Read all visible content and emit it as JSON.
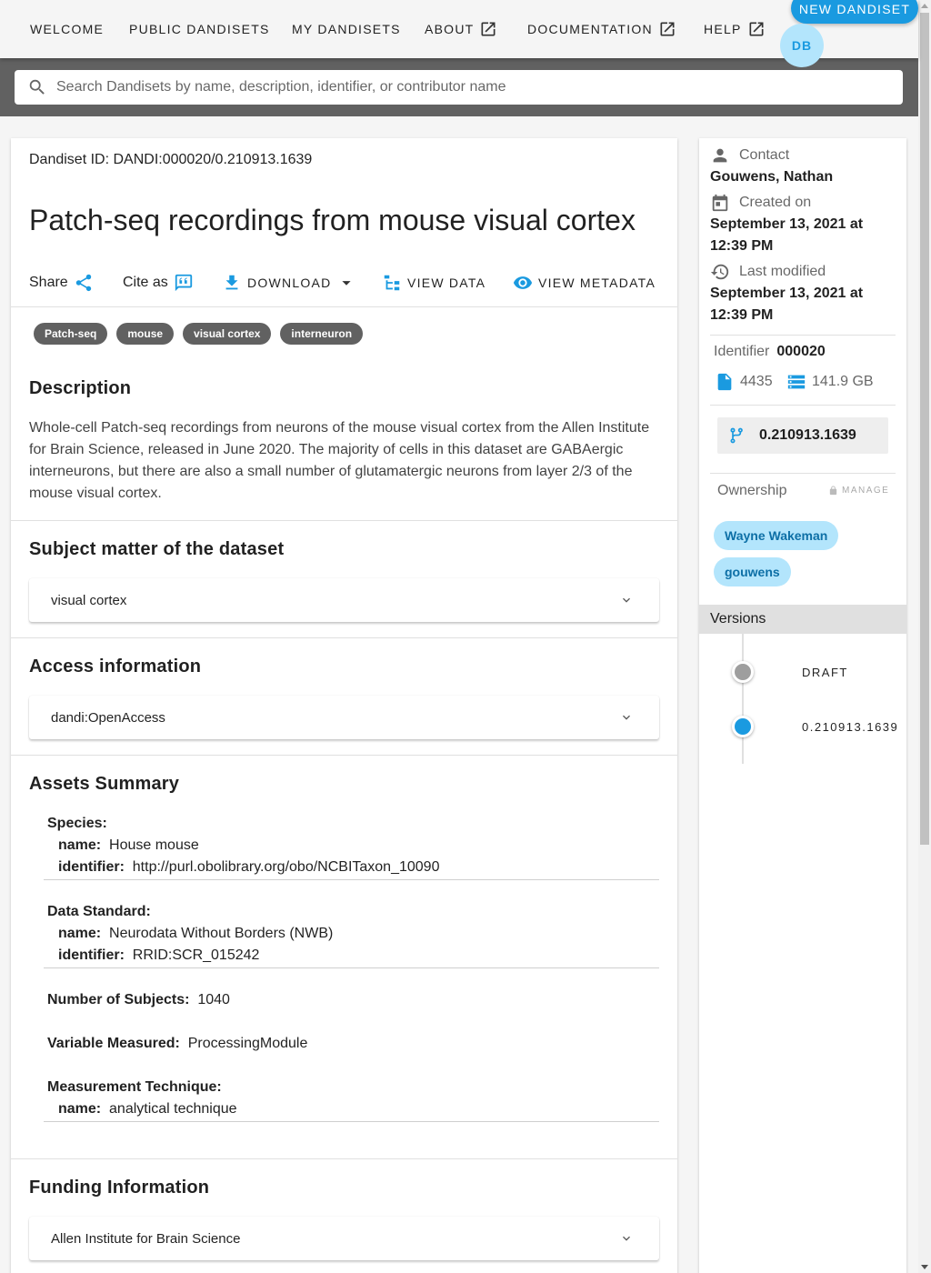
{
  "nav": {
    "items": [
      {
        "label": "WELCOME"
      },
      {
        "label": "PUBLIC DANDISETS"
      },
      {
        "label": "MY DANDISETS"
      },
      {
        "label": "ABOUT",
        "icon": "external-link-icon"
      },
      {
        "label": "DOCUMENTATION",
        "icon": "external-link-icon"
      },
      {
        "label": "HELP",
        "icon": "external-link-icon"
      }
    ],
    "new_button": "NEW DANDISET",
    "avatar_initials": "DB"
  },
  "search": {
    "placeholder": "Search Dandisets by name, description, identifier, or contributor name",
    "value": ""
  },
  "dandiset": {
    "id_text": "Dandiset ID: DANDI:000020/0.210913.1639",
    "title": "Patch-seq recordings from mouse visual cortex",
    "actions": {
      "share": "Share",
      "cite": "Cite as",
      "download": "DOWNLOAD",
      "view_data": "VIEW DATA",
      "view_metadata": "VIEW METADATA"
    },
    "keywords": [
      "Patch-seq",
      "mouse",
      "visual cortex",
      "interneuron"
    ],
    "description_title": "Description",
    "description": "Whole-cell Patch-seq recordings from neurons of the mouse visual cortex from the Allen Institute for Brain Science, released in June 2020. The majority of cells in this dataset are GABAergic interneurons, but there are also a small number of glutamatergic neurons from layer 2/3 of the mouse visual cortex.",
    "subject_title": "Subject matter of the dataset",
    "subject_value": "visual cortex",
    "access_title": "Access information",
    "access_value": "dandi:OpenAccess",
    "assets_title": "Assets Summary",
    "assets": {
      "species_label": "Species:",
      "species_name_label": "name:",
      "species_name": "House mouse",
      "species_id_label": "identifier:",
      "species_id": "http://purl.obolibrary.org/obo/NCBITaxon_10090",
      "standard_label": "Data Standard:",
      "standard_name_label": "name:",
      "standard_name": "Neurodata Without Borders (NWB)",
      "standard_id_label": "identifier:",
      "standard_id": "RRID:SCR_015242",
      "subjects_label": "Number of Subjects:",
      "subjects_value": "1040",
      "variable_label": "Variable Measured:",
      "variable_value": "ProcessingModule",
      "technique_label": "Measurement Technique:",
      "technique_name_label": "name:",
      "technique_name": "analytical technique"
    },
    "funding_title": "Funding Information",
    "funding_value": "Allen Institute for Brain Science"
  },
  "sidebar": {
    "contact_label": "Contact",
    "contact_value": "Gouwens, Nathan",
    "created_label": "Created on",
    "created_value": "September 13, 2021 at 12:39 PM",
    "modified_label": "Last modified",
    "modified_value": "September 13, 2021 at 12:39 PM",
    "identifier_label": "Identifier",
    "identifier_value": "000020",
    "file_count": "4435",
    "size": "141.9 GB",
    "version": "0.210913.1639",
    "ownership_label": "Ownership",
    "manage_label": "MANAGE",
    "owners": [
      "Wayne Wakeman",
      "gouwens"
    ],
    "versions_label": "Versions",
    "versions": [
      {
        "label": "DRAFT",
        "color": "#9e9e9e"
      },
      {
        "label": "0.210913.1639",
        "color": "#1a9ae0"
      }
    ]
  },
  "colors": {
    "accent": "#1a9ae0",
    "chip_dark": "#616161",
    "chip_light": "#b3e5fc"
  }
}
